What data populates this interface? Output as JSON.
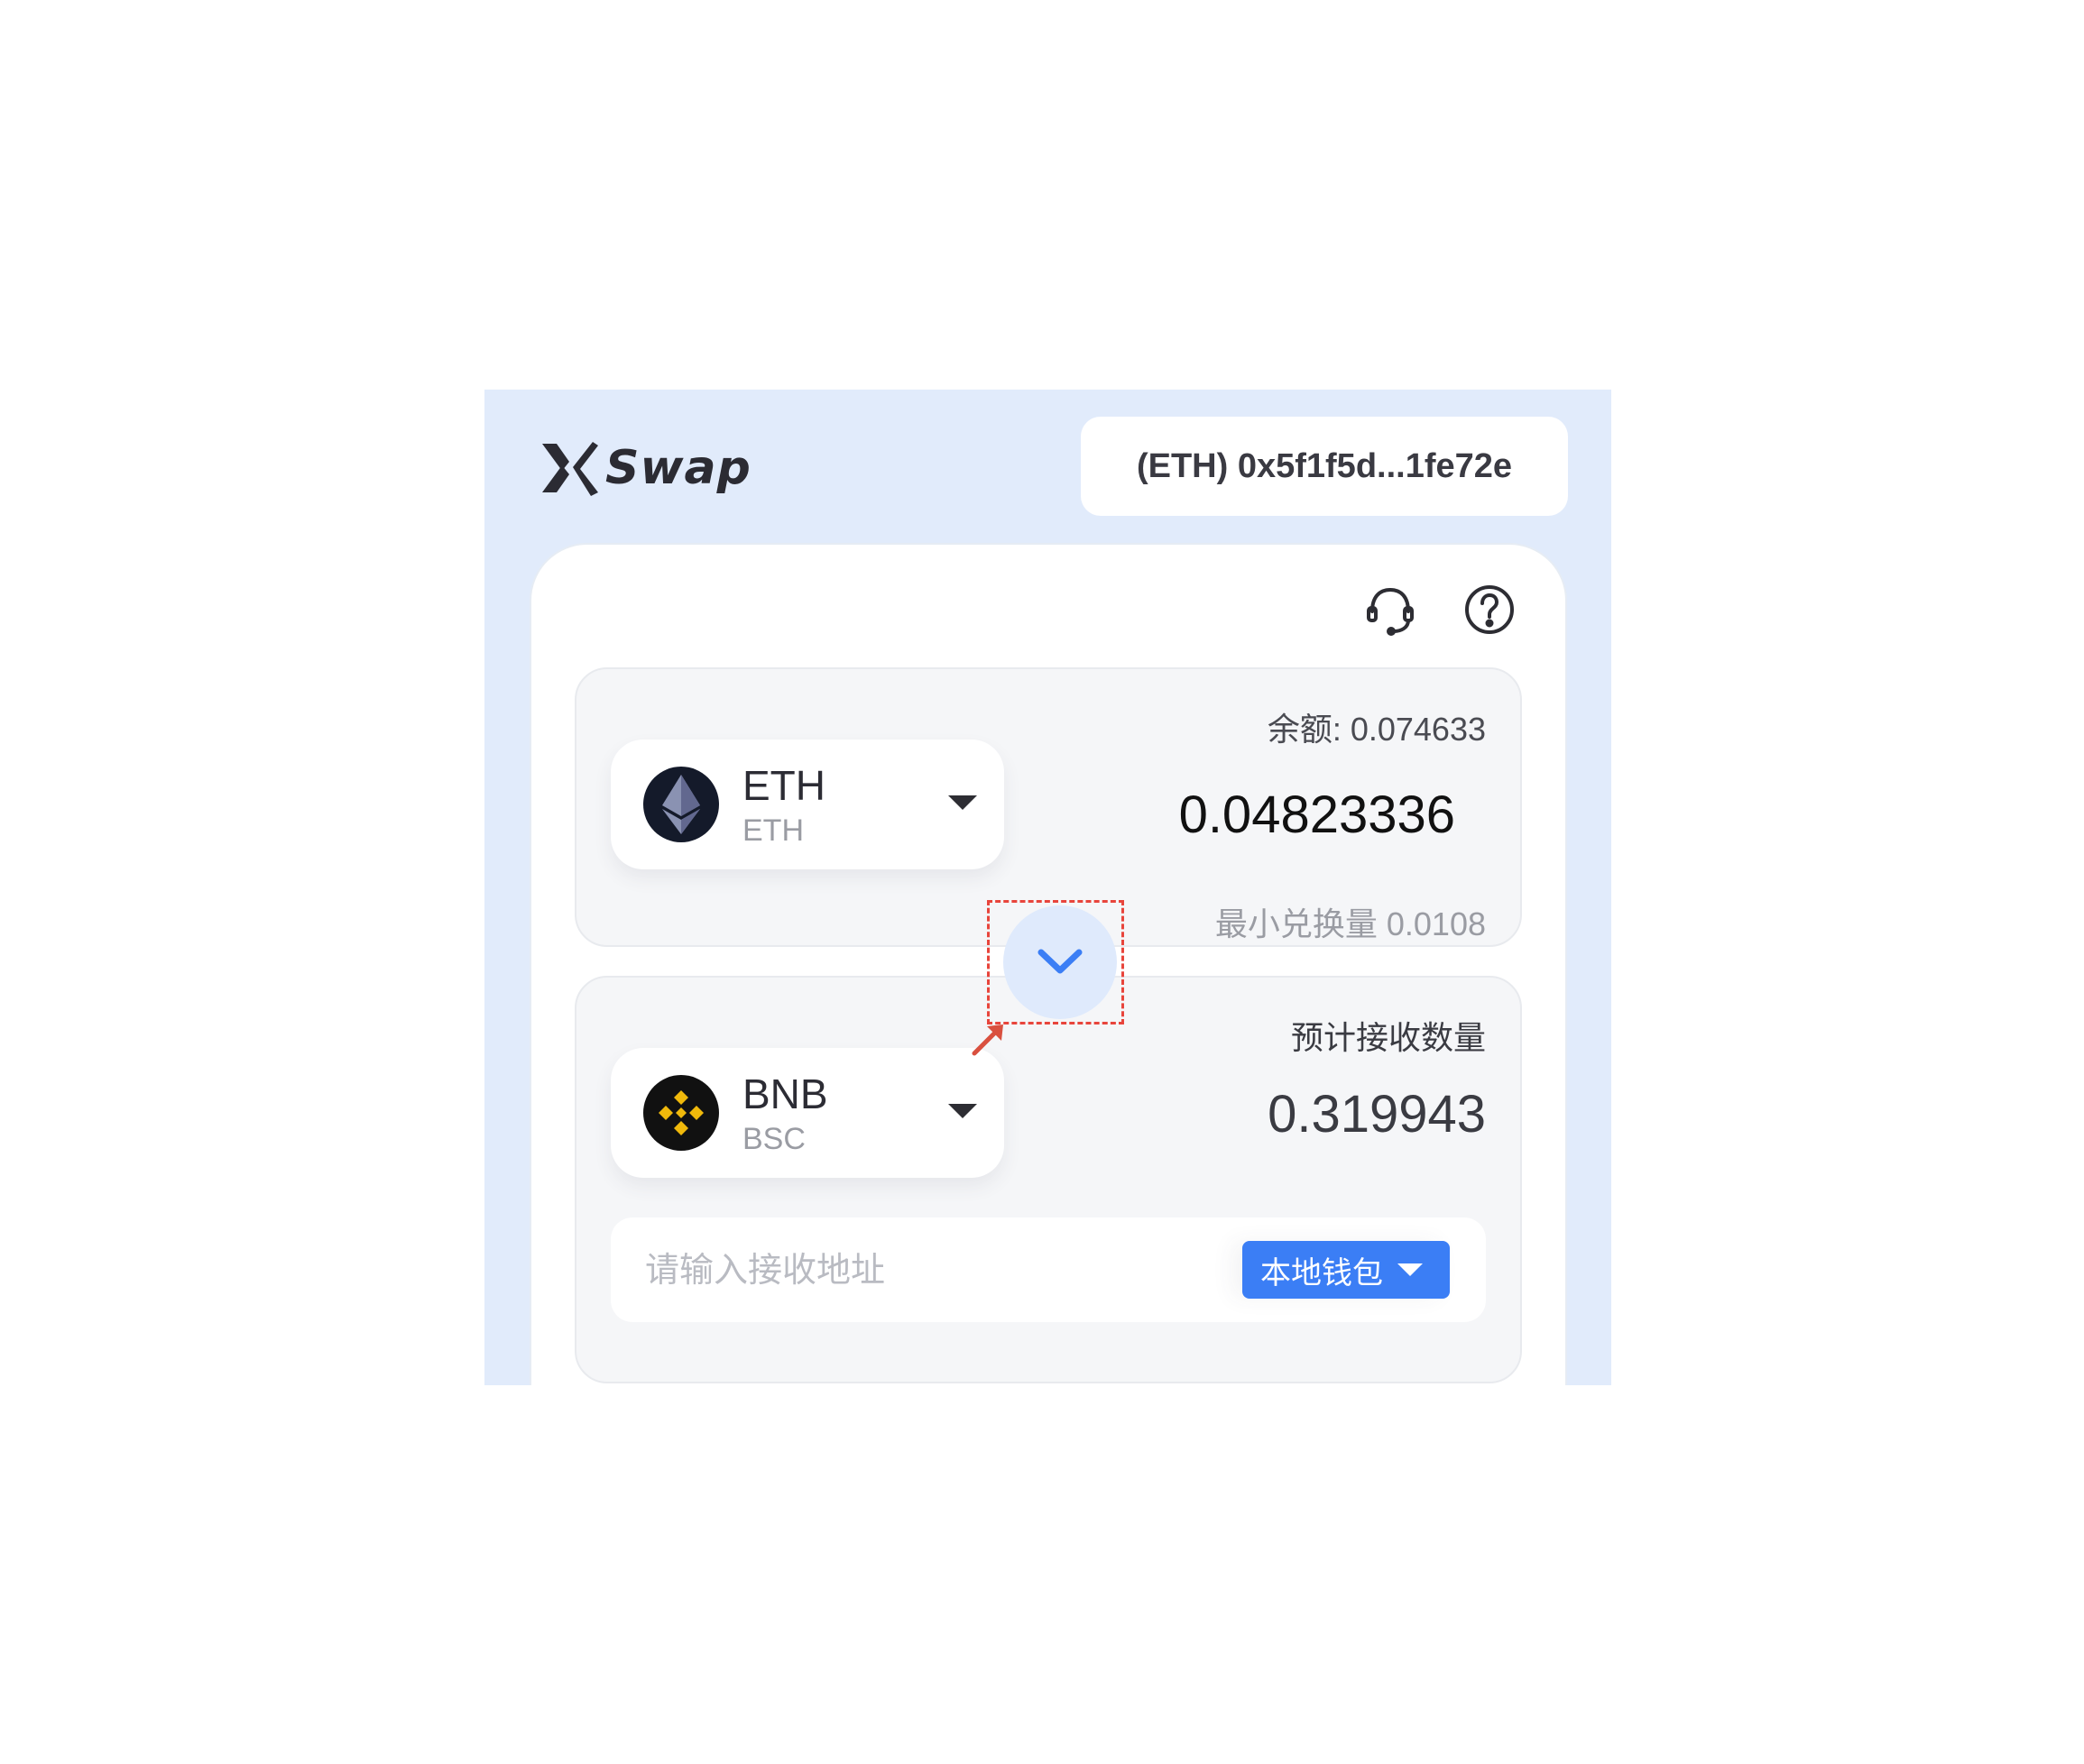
{
  "app": {
    "brand": "Swap",
    "wallet_address": "(ETH) 0x5f1f5d...1fe72e",
    "accent_color": "#3b7ef5",
    "background_color": "#e1ebfb"
  },
  "toolbar": {
    "support_icon": "headset-icon",
    "help_icon": "question-circle-icon"
  },
  "from": {
    "token_symbol": "ETH",
    "token_chain": "ETH",
    "token_icon": "ethereum-icon",
    "balance_text": "余额: 0.074633",
    "amount": "0.04823336",
    "min_amount_text": "最小兑换量 0.0108"
  },
  "swap_button": {
    "icon": "chevron-down-icon",
    "highlight_color": "#e8453c"
  },
  "to": {
    "token_symbol": "BNB",
    "token_chain": "BSC",
    "token_icon": "binance-icon",
    "receive_label": "预计接收数量",
    "receive_amount": "0.319943",
    "address_placeholder": "请输入接收地址",
    "wallet_choice_label": "本地钱包"
  }
}
